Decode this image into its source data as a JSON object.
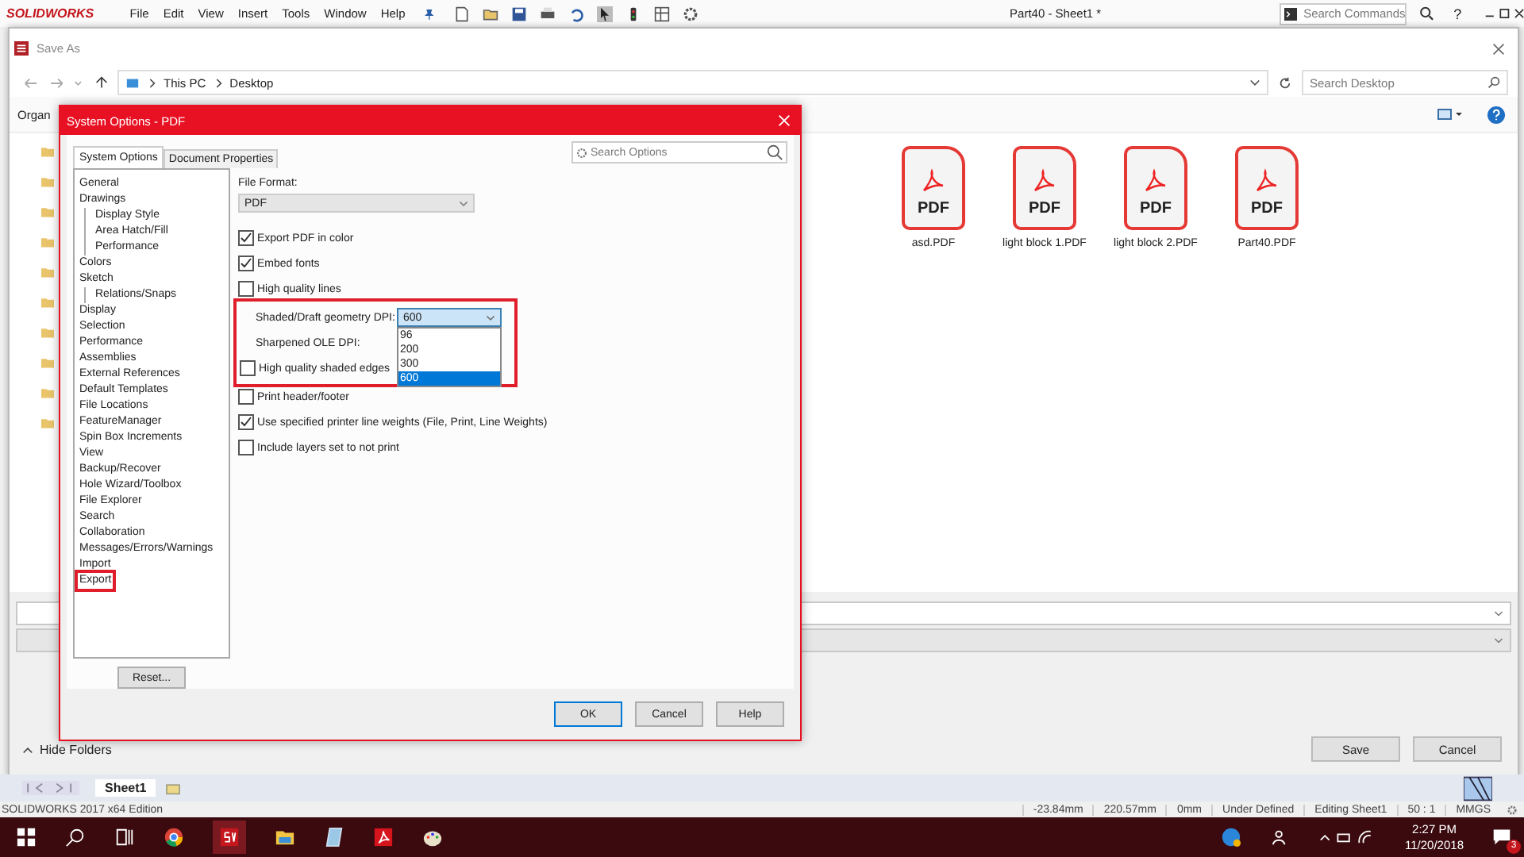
{
  "app": {
    "brand": "SOLIDWORKS",
    "menus": [
      "File",
      "Edit",
      "View",
      "Insert",
      "Tools",
      "Window",
      "Help"
    ],
    "title": "Part40 - Sheet1 *",
    "search_placeholder": "Search Commands",
    "help": "?"
  },
  "save_as": {
    "title": "Save As",
    "path": [
      "This PC",
      "Desktop"
    ],
    "search_placeholder": "Search Desktop",
    "toolbar_label": "Organ",
    "files": [
      {
        "name": "asd.PDF",
        "badge": "PDF"
      },
      {
        "name": "light block 1.PDF",
        "badge": "PDF"
      },
      {
        "name": "light block 2.PDF",
        "badge": "PDF"
      },
      {
        "name": "Part40.PDF",
        "badge": "PDF"
      }
    ],
    "hide_folders": "Hide Folders",
    "buttons": [
      "Save",
      "Cancel"
    ]
  },
  "options_dialog": {
    "title": "System Options - PDF",
    "tabs": [
      {
        "label": "System Options",
        "selected": true
      },
      {
        "label": "Document Properties",
        "selected": false
      }
    ],
    "search_placeholder": "Search Options",
    "tree": [
      {
        "label": "General",
        "highlighted": false
      },
      {
        "label": "Drawings",
        "highlighted": false,
        "children": [
          {
            "label": "Display Style",
            "highlighted": false
          },
          {
            "label": "Area Hatch/Fill",
            "highlighted": false
          },
          {
            "label": "Performance",
            "highlighted": false
          }
        ]
      },
      {
        "label": "Colors",
        "highlighted": false
      },
      {
        "label": "Sketch",
        "highlighted": false,
        "children": [
          {
            "label": "Relations/Snaps",
            "highlighted": false
          }
        ]
      },
      {
        "label": "Display",
        "highlighted": false
      },
      {
        "label": "Selection",
        "highlighted": false
      },
      {
        "label": "Performance",
        "highlighted": false
      },
      {
        "label": "Assemblies",
        "highlighted": false
      },
      {
        "label": "External References",
        "highlighted": false
      },
      {
        "label": "Default Templates",
        "highlighted": false
      },
      {
        "label": "File Locations",
        "highlighted": false
      },
      {
        "label": "FeatureManager",
        "highlighted": false
      },
      {
        "label": "Spin Box Increments",
        "highlighted": false
      },
      {
        "label": "View",
        "highlighted": false
      },
      {
        "label": "Backup/Recover",
        "highlighted": false
      },
      {
        "label": "Hole Wizard/Toolbox",
        "highlighted": false
      },
      {
        "label": "File Explorer",
        "highlighted": false
      },
      {
        "label": "Search",
        "highlighted": false
      },
      {
        "label": "Collaboration",
        "highlighted": false
      },
      {
        "label": "Messages/Errors/Warnings",
        "highlighted": false
      },
      {
        "label": "Import",
        "highlighted": false
      },
      {
        "label": "Export",
        "highlighted": true
      }
    ],
    "file_format_label": "File Format:",
    "file_format": "PDF",
    "options": [
      {
        "kind": "checkbox",
        "label": "Export PDF in color",
        "checked": true
      },
      {
        "kind": "checkbox",
        "label": "Embed fonts",
        "checked": true
      },
      {
        "kind": "checkbox",
        "label": "High quality lines",
        "checked": false
      },
      {
        "kind": "group",
        "highlighted": true,
        "items": [
          {
            "kind": "dropdown",
            "label": "Shaded/Draft geometry DPI:",
            "value": "600",
            "expanded": true,
            "choices": [
              {
                "label": "96",
                "selected": false
              },
              {
                "label": "200",
                "selected": false
              },
              {
                "label": "300",
                "selected": false
              },
              {
                "label": "600",
                "selected": true
              }
            ]
          },
          {
            "kind": "text",
            "label": "Sharpened OLE DPI:"
          },
          {
            "kind": "checkbox",
            "label": "High quality shaded edges",
            "checked": false
          }
        ]
      },
      {
        "kind": "checkbox",
        "label": "Print header/footer",
        "checked": false
      },
      {
        "kind": "checkbox",
        "label": "Use specified printer line weights (File, Print, Line Weights)",
        "checked": true
      },
      {
        "kind": "checkbox",
        "label": "Include layers set to not print",
        "checked": false
      }
    ],
    "reset": "Reset...",
    "buttons": [
      "OK",
      "Cancel",
      "Help"
    ]
  },
  "sheet_tab": "Sheet1",
  "status_bar": {
    "edition": "SOLIDWORKS 2017 x64 Edition",
    "fields": [
      "-23.84mm",
      "220.57mm",
      "0mm",
      "Under Defined",
      "Editing Sheet1",
      "50 : 1",
      "MMGS"
    ]
  },
  "taskbar": {
    "time": "2:27 PM",
    "date": "11/20/2018",
    "notifications": "3"
  }
}
